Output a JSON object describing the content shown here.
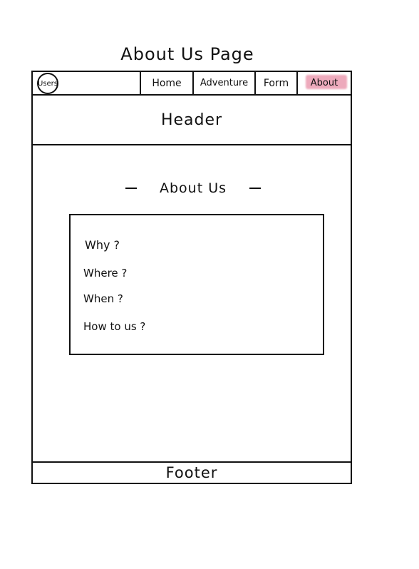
{
  "page_title": "About Us Page",
  "nav": {
    "users_label": "Users",
    "items": [
      {
        "label": "Home"
      },
      {
        "label": "Adventure"
      },
      {
        "label": "Form"
      },
      {
        "label": "About"
      }
    ],
    "active_highlight_color": "#e88ea6"
  },
  "header": {
    "label": "Header"
  },
  "section": {
    "title": "About Us"
  },
  "about_box": {
    "questions": [
      "Why ?",
      "Where ?",
      "When ?",
      "How to us ?"
    ]
  },
  "footer": {
    "label": "Footer"
  }
}
